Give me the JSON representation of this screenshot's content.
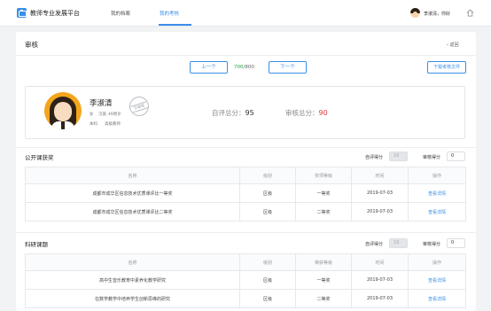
{
  "app": {
    "title": "教师专业发展平台"
  },
  "nav": [
    {
      "label": "我的档案",
      "active": false
    },
    {
      "label": "我的考核",
      "active": true
    }
  ],
  "user": {
    "greeting": "李淑清，你好"
  },
  "page": {
    "title": "审核",
    "back_label": "返回",
    "download_label": "下载考核文件"
  },
  "pager": {
    "prev_label": "上一个",
    "next_label": "下一个",
    "current": "700",
    "total": "/800"
  },
  "teacher": {
    "name": "李淑清",
    "gender": "女",
    "ethnicity": "汉族",
    "age_label": "49周岁",
    "education": "本科",
    "title": "高级教师",
    "stamp_label": "已审核"
  },
  "scores": {
    "self_label": "自评总分：",
    "self_value": "95",
    "review_label": "审核总分：",
    "review_value": "90",
    "review_color": "#e23b3b"
  },
  "sections": [
    {
      "title": "公开课获奖",
      "self_score_label": "自评得分",
      "self_score_value": "16",
      "review_score_label": "审核得分",
      "review_score_value": "0",
      "columns": [
        "名称",
        "级别",
        "奖项等级",
        "时间",
        "操作"
      ],
      "rows": [
        [
          "成都市成华区信息技术优质课评比一等奖",
          "区级",
          "一等奖",
          "2019-07-03",
          "查看详情"
        ],
        [
          "成都市成华区信息技术优质课评比二等奖",
          "区级",
          "二等奖",
          "2019-07-03",
          "查看详情"
        ]
      ]
    },
    {
      "title": "科研课题",
      "self_score_label": "自评得分",
      "self_score_value": "16",
      "review_score_label": "审核得分",
      "review_score_value": "0",
      "columns": [
        "名称",
        "级别",
        "荣获等级",
        "时间",
        "操作"
      ],
      "rows": [
        [
          "高中生音乐教育中素养化教学研究",
          "区级",
          "一等奖",
          "2019-07-03",
          "查看详情"
        ],
        [
          "在数学教学中培养学生创新思维的研究",
          "区级",
          "二等奖",
          "2019-07-03",
          "查看详情"
        ]
      ]
    }
  ],
  "colors": {
    "accent": "#3a8fe8",
    "pager_current": "#2a9e3e",
    "review_score": "#e23b3b"
  },
  "icons": [
    "app-logo-icon",
    "chevron-left-icon",
    "home-icon"
  ]
}
